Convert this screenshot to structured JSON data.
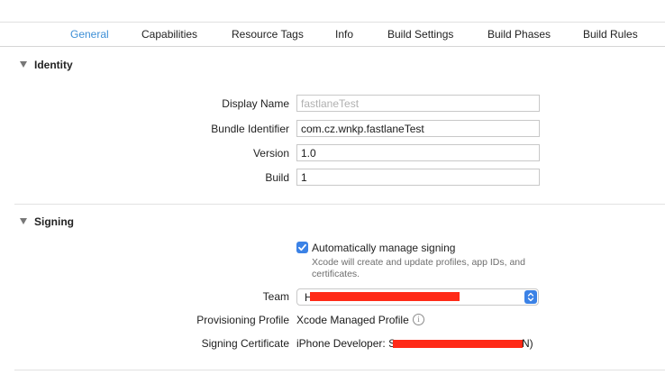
{
  "tabs": [
    {
      "label": "General",
      "selected": true
    },
    {
      "label": "Capabilities"
    },
    {
      "label": "Resource Tags"
    },
    {
      "label": "Info"
    },
    {
      "label": "Build Settings"
    },
    {
      "label": "Build Phases"
    },
    {
      "label": "Build Rules"
    }
  ],
  "identity": {
    "title": "Identity",
    "display_name": {
      "label": "Display Name",
      "value": "",
      "placeholder": "fastlaneTest"
    },
    "bundle_identifier": {
      "label": "Bundle Identifier",
      "value": "com.cz.wnkp.fastlaneTest"
    },
    "version": {
      "label": "Version",
      "value": "1.0"
    },
    "build": {
      "label": "Build",
      "value": "1"
    }
  },
  "signing": {
    "title": "Signing",
    "auto_manage": {
      "label": "Automatically manage signing",
      "checked": true,
      "description": "Xcode will create and update profiles, app IDs, and certificates."
    },
    "team": {
      "label": "Team",
      "value": "H"
    },
    "provisioning_profile": {
      "label": "Provisioning Profile",
      "value": "Xcode Managed Profile"
    },
    "signing_certificate": {
      "label": "Signing Certificate",
      "value_prefix": "iPhone Developer: S",
      "value_suffix": "N)"
    }
  },
  "colors": {
    "accent": "#3b82e6",
    "selected_tab": "#3d8fd6",
    "redaction": "#ff2a17"
  },
  "icons": {
    "disclosure": "triangle-down-icon",
    "checkbox": "checkmark-icon",
    "popup": "up-down-chevron-icon",
    "info": "info-circle-icon"
  }
}
